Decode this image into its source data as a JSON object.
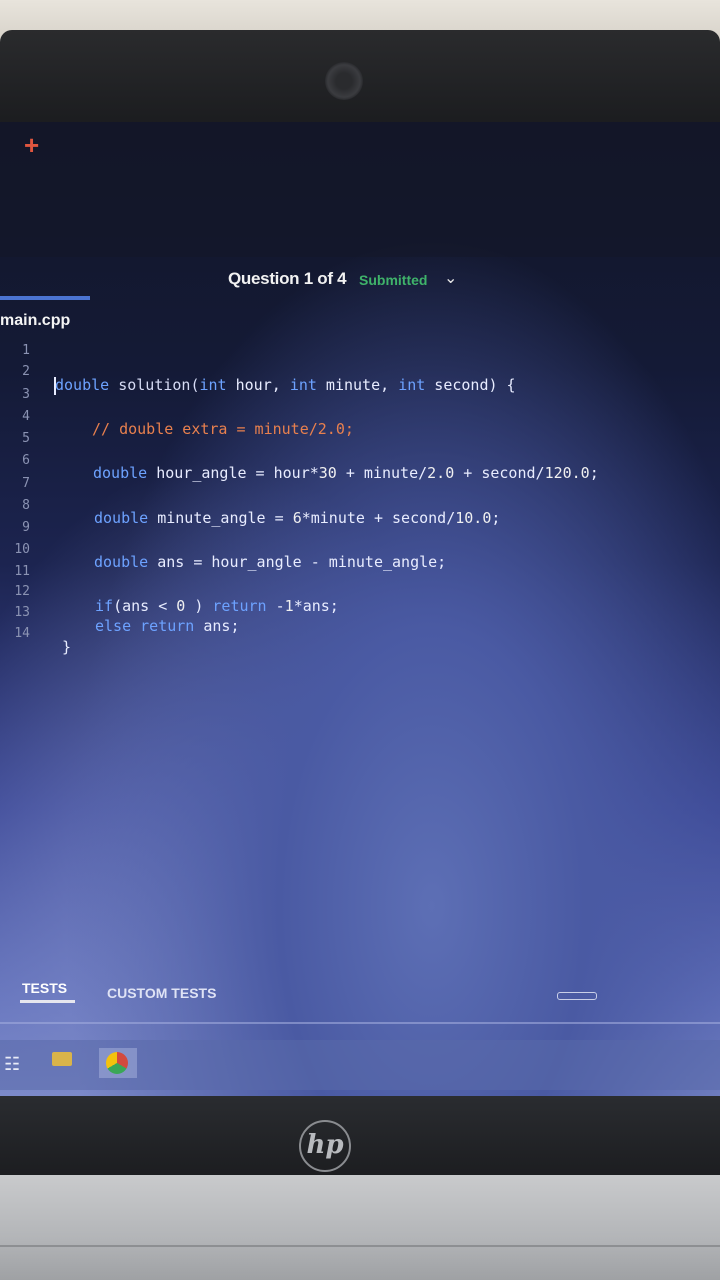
{
  "header": {
    "question": "Question 1 of 4",
    "status": "Submitted",
    "new_tab_icon": "plus-icon"
  },
  "editor": {
    "file_name": "main.cpp",
    "lines": [
      {
        "n": "1",
        "text": "double solution(int hour, int minute, int second) {"
      },
      {
        "n": "2",
        "text": ""
      },
      {
        "n": "3",
        "text": "// double extra = minute/2.0;"
      },
      {
        "n": "4",
        "text": ""
      },
      {
        "n": "5",
        "text": "double hour_angle = hour*30 + minute/2.0 + second/120.0;"
      },
      {
        "n": "6",
        "text": ""
      },
      {
        "n": "7",
        "text": "double minute_angle = 6*minute + second/10.0;"
      },
      {
        "n": "8",
        "text": ""
      },
      {
        "n": "9",
        "text": "double ans = hour_angle - minute_angle;"
      },
      {
        "n": "10",
        "text": ""
      },
      {
        "n": "11",
        "text": "if(ans < 0 ) return -1*ans;"
      },
      {
        "n": "12",
        "text": "else return ans;"
      },
      {
        "n": "13",
        "text": "}"
      },
      {
        "n": "14",
        "text": ""
      }
    ]
  },
  "bottom_tabs": {
    "tests": "TESTS",
    "custom_tests": "CUSTOM TESTS"
  },
  "taskbar": {
    "items": [
      "task-view-icon",
      "file-explorer-icon",
      "chrome-icon"
    ]
  },
  "brand": {
    "logo": "hp"
  }
}
